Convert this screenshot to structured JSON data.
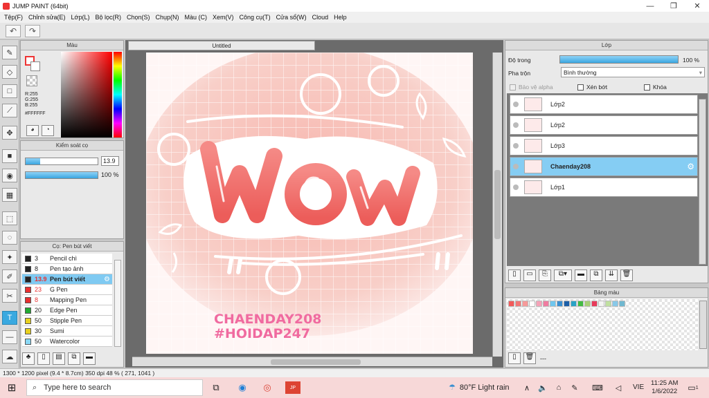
{
  "window": {
    "title": "JUMP PAINT (64bit)",
    "min": "—",
    "max": "❐",
    "close": "✕"
  },
  "menu": [
    "Tệp(F)",
    "Chỉnh sửa(E)",
    "Lớp(L)",
    "Bộ lọc(R)",
    "Chọn(S)",
    "Chụp(N)",
    "Màu (C)",
    "Xem(V)",
    "Công cụ(T)",
    "Cửa sổ(W)",
    "Cloud",
    "Help"
  ],
  "color_panel": {
    "title": "Màu",
    "r": "R:255",
    "g": "G:255",
    "b": "B:255",
    "hex": "#FFFFFF"
  },
  "brush_control": {
    "title": "Kiểm soát cọ",
    "size_value": "13.9",
    "size_fill": 0.2,
    "opacity_value": "100 %",
    "opacity_fill": 1.0
  },
  "brush_list": {
    "title": "Cọ: Pen bút viết",
    "items": [
      {
        "size": "3",
        "name": "Pencil chì",
        "color": "#222222",
        "selected": false
      },
      {
        "size": "8",
        "name": "Pen tạo ảnh",
        "color": "#222222",
        "selected": false
      },
      {
        "size": "13.9",
        "name": "Pen bút viết",
        "color": "#222222",
        "selected": true
      },
      {
        "size": "23",
        "name": "G Pen",
        "color": "#e83030",
        "selected": false
      },
      {
        "size": "8",
        "name": "Mapping Pen",
        "color": "#e83030",
        "selected": false
      },
      {
        "size": "20",
        "name": "Edge Pen",
        "color": "#22aa33",
        "selected": false
      },
      {
        "size": "50",
        "name": "Stipple Pen",
        "color": "#e8d020",
        "selected": false
      },
      {
        "size": "30",
        "name": "Sumi",
        "color": "#e8d020",
        "selected": false
      },
      {
        "size": "50",
        "name": "Watercolor",
        "color": "#8ad8f5",
        "selected": false
      }
    ]
  },
  "canvas": {
    "tab": "Untitled",
    "art_word": "wow",
    "signature1": "CHAENDAY208",
    "signature2": "#HOIDAP247"
  },
  "layer_panel": {
    "title": "Lớp",
    "opacity_label": "Độ trong",
    "opacity_value": "100 %",
    "blend_label": "Pha trộn",
    "blend_value": "Bình thường",
    "protect_alpha": "Bảo vệ alpha",
    "clip": "Xén bớt",
    "lock": "Khóa",
    "layers": [
      {
        "name": "Lớp2",
        "selected": false
      },
      {
        "name": "Lớp2",
        "selected": false
      },
      {
        "name": "Lớp3",
        "selected": false
      },
      {
        "name": "Chaenday208",
        "selected": true
      },
      {
        "name": "Lớp1",
        "selected": false
      }
    ]
  },
  "swatch_panel": {
    "title": "Bảng màu",
    "footer": "---",
    "colors": [
      "#f25a5a",
      "#f27777",
      "#f69a9a",
      "#ffffff",
      "#f5a3b8",
      "#f07ca0",
      "#6fc6ee",
      "#3a8fd0",
      "#1c5fa8",
      "#2aa3c6",
      "#44bb44",
      "#a8d078",
      "#e83a5a",
      "#f4f4f4",
      "#c0e0a0",
      "#88c8e8",
      "#70b8d0"
    ]
  },
  "status": {
    "text": "1300 * 1200 pixel   (9.4 * 8.7cm)   350 dpi   48 %   ( 271, 1041 )"
  },
  "taskbar": {
    "search_placeholder": "Type here to search",
    "weather": "80°F  Light rain",
    "lang": "VIE",
    "time": "11:25 AM",
    "date": "1/6/2022",
    "notif": "1"
  }
}
